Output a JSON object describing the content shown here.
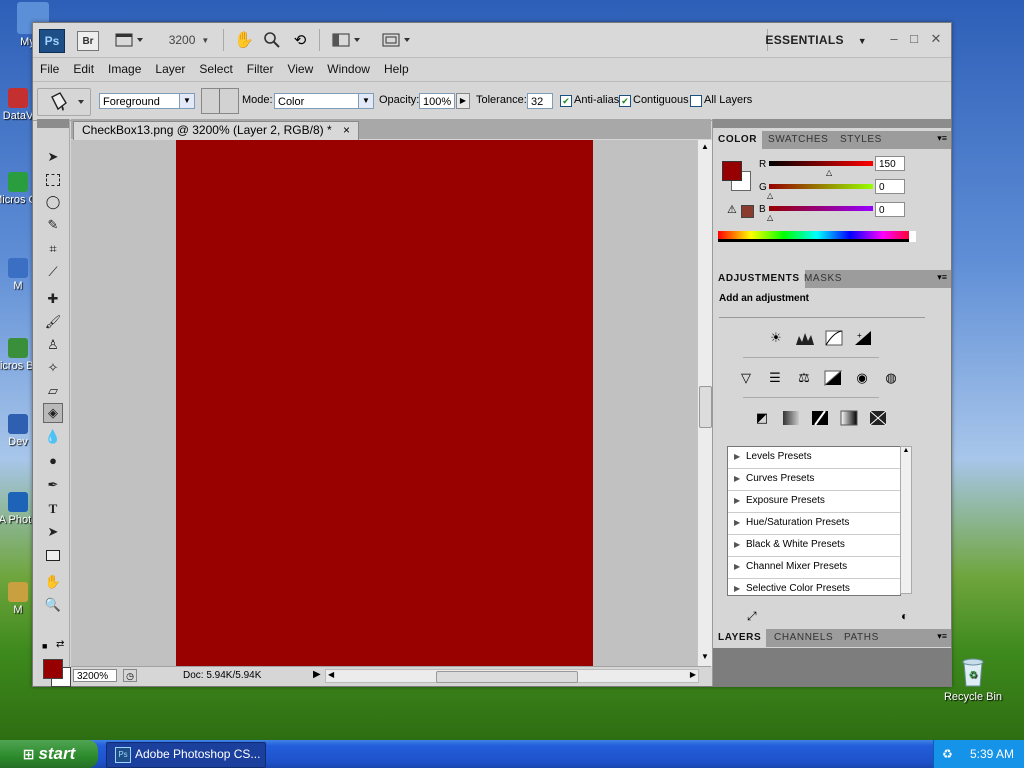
{
  "desktop": {
    "icons": [
      {
        "label": "My C",
        "color": "#5b8fd8"
      },
      {
        "label": "DataV",
        "color": "#c43030"
      },
      {
        "label": "Micros C+",
        "color": "#2a9d3f"
      },
      {
        "label": "M",
        "color": "#3a6fc4"
      },
      {
        "label": "Micros Bas",
        "color": "#3a8f3a"
      },
      {
        "label": "Dev",
        "color": "#2e5fb0"
      },
      {
        "label": "A Photo",
        "color": "#1d63b8"
      },
      {
        "label": "M",
        "color": "#c9a040"
      }
    ],
    "recycle_bin": {
      "label": "Recycle Bin"
    }
  },
  "photoshop": {
    "logo": "Ps",
    "bridge_logo": "Br",
    "zoom_select": "3200",
    "workspace": "ESSENTIALS",
    "window_buttons": [
      "–",
      "□",
      "✕"
    ],
    "menu": [
      "File",
      "Edit",
      "Image",
      "Layer",
      "Select",
      "Filter",
      "View",
      "Window",
      "Help"
    ],
    "options": {
      "fill_source": "Foreground",
      "mode_label": "Mode:",
      "mode_value": "Color",
      "opacity_label": "Opacity:",
      "opacity_value": "100%",
      "tolerance_label": "Tolerance:",
      "tolerance_value": "32",
      "anti_alias": {
        "label": "Anti-alias",
        "checked": true
      },
      "contiguous": {
        "label": "Contiguous",
        "checked": true
      },
      "all_layers": {
        "label": "All Layers",
        "checked": false
      }
    },
    "document": {
      "tab_title": "CheckBox13.png @ 3200% (Layer 2, RGB/8) *",
      "close": "×",
      "canvas_color": "#990000",
      "zoom": "3200%",
      "doc_info": "Doc: 5.94K/5.94K"
    },
    "toolbox": {
      "foreground_color": "#960000",
      "background_color": "#ffffff",
      "tools": [
        "move",
        "marquee",
        "lasso",
        "quick-select",
        "crop",
        "eyedropper",
        "healing",
        "brush",
        "stamp",
        "history-brush",
        "eraser",
        "paint-bucket",
        "blur",
        "dodge",
        "pen",
        "type",
        "path-select",
        "shape",
        "hand",
        "zoom"
      ]
    },
    "color_panel": {
      "tabs": [
        "COLOR",
        "SWATCHES",
        "STYLES"
      ],
      "r_label": "R",
      "r_value": "150",
      "g_label": "G",
      "g_value": "0",
      "b_label": "B",
      "b_value": "0",
      "swatch_color": "#960000"
    },
    "adjustments_panel": {
      "tabs": [
        "ADJUSTMENTS",
        "MASKS"
      ],
      "title": "Add an adjustment",
      "presets": [
        "Levels Presets",
        "Curves Presets",
        "Exposure Presets",
        "Hue/Saturation Presets",
        "Black & White Presets",
        "Channel Mixer Presets",
        "Selective Color Presets"
      ]
    },
    "layers_panel": {
      "tabs": [
        "LAYERS",
        "CHANNELS",
        "PATHS"
      ]
    }
  },
  "taskbar": {
    "start_label": "start",
    "task_button": "Adobe Photoshop CS...",
    "clock": "5:39 AM"
  }
}
